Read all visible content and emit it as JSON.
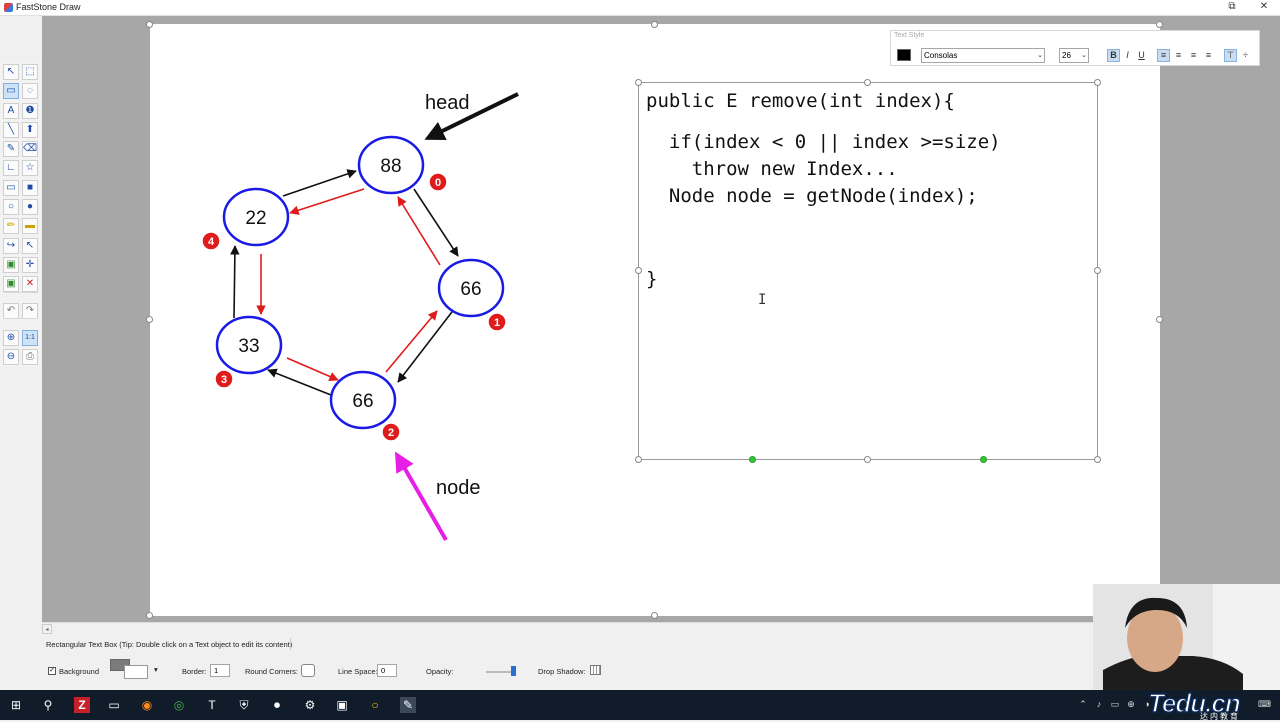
{
  "window": {
    "title": "FastStone Draw",
    "restore_glyph": "⧉",
    "close_glyph": "✕"
  },
  "toolbox": {
    "tools": [
      {
        "icon": "arrow-select-icon",
        "glyph": "↖"
      },
      {
        "icon": "rect-select-icon",
        "glyph": "⬚"
      },
      {
        "icon": "callout-icon",
        "glyph": "▭"
      },
      {
        "icon": "lasso-icon",
        "glyph": "◌"
      },
      {
        "icon": "text-icon",
        "glyph": "A"
      },
      {
        "icon": "number-icon",
        "glyph": "❶"
      },
      {
        "icon": "line-icon",
        "glyph": "╲"
      },
      {
        "icon": "up-arrow-icon",
        "glyph": "⬆"
      },
      {
        "icon": "pencil-icon",
        "glyph": "✎"
      },
      {
        "icon": "eraser-icon",
        "glyph": "⌫"
      },
      {
        "icon": "angle-line-icon",
        "glyph": "∟"
      },
      {
        "icon": "star-icon",
        "glyph": "☆"
      },
      {
        "icon": "rectangle-icon",
        "glyph": "▭"
      },
      {
        "icon": "filled-rectangle-icon",
        "glyph": "■"
      },
      {
        "icon": "ellipse-icon",
        "glyph": "○"
      },
      {
        "icon": "filled-ellipse-icon",
        "glyph": "●"
      },
      {
        "icon": "highlighter-icon",
        "glyph": "✏"
      },
      {
        "icon": "yellow-marker-icon",
        "glyph": "▬"
      },
      {
        "icon": "curved-arrow-icon",
        "glyph": "↪"
      },
      {
        "icon": "pointer-star-icon",
        "glyph": "↖"
      },
      {
        "icon": "image-icon",
        "glyph": "▣"
      },
      {
        "icon": "crosshair-icon",
        "glyph": "✛"
      },
      {
        "icon": "insert-image-icon",
        "glyph": "▣"
      },
      {
        "icon": "delete-icon",
        "glyph": "✕"
      },
      {
        "icon": "undo-icon",
        "glyph": "↶"
      },
      {
        "icon": "redo-icon",
        "glyph": "↷"
      },
      {
        "icon": "zoom-icon",
        "glyph": "⊕"
      },
      {
        "icon": "actual-size-icon",
        "glyph": "1:1"
      },
      {
        "icon": "zoom-out-icon",
        "glyph": "⊖"
      },
      {
        "icon": "print-icon",
        "glyph": "⎙"
      }
    ]
  },
  "diagram": {
    "nodes": [
      {
        "value": "88",
        "badge": "0"
      },
      {
        "value": "66",
        "badge": "1"
      },
      {
        "value": "66",
        "badge": "2"
      },
      {
        "value": "33",
        "badge": "3"
      },
      {
        "value": "22",
        "badge": "4"
      }
    ],
    "head_label": "head",
    "node_label": "node",
    "colors": {
      "node_border": "#1a1ae6",
      "next_arrow": "#111111",
      "prev_arrow": "#e01b1b",
      "badge": "#e01b1b",
      "pointer_arrow": "#e61ee6"
    }
  },
  "code": {
    "lines": [
      "public E remove(int index){",
      "  if(index < 0 || index >=size)",
      "    throw new Index...",
      "  Node node = getNode(index);",
      "}"
    ]
  },
  "text_style": {
    "caption": "Text Style",
    "font": "Consolas",
    "size": "26",
    "dropdown_glyph": "⌄",
    "buttons": {
      "bold": "B",
      "italic": "I",
      "underline": "U",
      "align_left": "≡",
      "align_center": "≡",
      "align_right": "≡",
      "justify": "≡",
      "valign_top": "⊤",
      "valign_mid": "÷"
    }
  },
  "status": {
    "text": "Rectangular Text Box (Tip: Double click on a Text object to edit its content)"
  },
  "properties": {
    "background_label": "Background",
    "background_checked": "✓",
    "border_label": "Border:",
    "border_value": "1",
    "round_corners_label": "Round Corners:",
    "line_space_label": "Line Space:",
    "line_space_value": "0",
    "opacity_label": "Opacity:",
    "drop_shadow_label": "Drop Shadow:",
    "color_dropdown": "▾"
  },
  "taskbar": {
    "items": [
      {
        "icon": "windows-start-icon",
        "glyph": "⊞"
      },
      {
        "icon": "search-icon",
        "glyph": "⚲"
      },
      {
        "icon": "filezilla-icon",
        "glyph": "Z"
      },
      {
        "icon": "monitor-icon",
        "glyph": "▭"
      },
      {
        "icon": "firefox-icon",
        "glyph": "◉"
      },
      {
        "icon": "chrome-icon",
        "glyph": "◎"
      },
      {
        "icon": "typora-icon",
        "glyph": "T"
      },
      {
        "icon": "shield-icon",
        "glyph": "⛨"
      },
      {
        "icon": "recorder-icon",
        "glyph": "⏺"
      },
      {
        "icon": "settings-icon",
        "glyph": "⚙"
      },
      {
        "icon": "intellij-icon",
        "glyph": "▣"
      },
      {
        "icon": "circle-app-icon",
        "glyph": "○"
      },
      {
        "icon": "faststone-draw-icon",
        "glyph": "✎"
      }
    ],
    "tray": [
      "⌃",
      "♪",
      "▭",
      "⊕",
      "◑",
      "⌨"
    ],
    "watermark": "Tedu.cn",
    "watermark_sub": "达内教育"
  }
}
